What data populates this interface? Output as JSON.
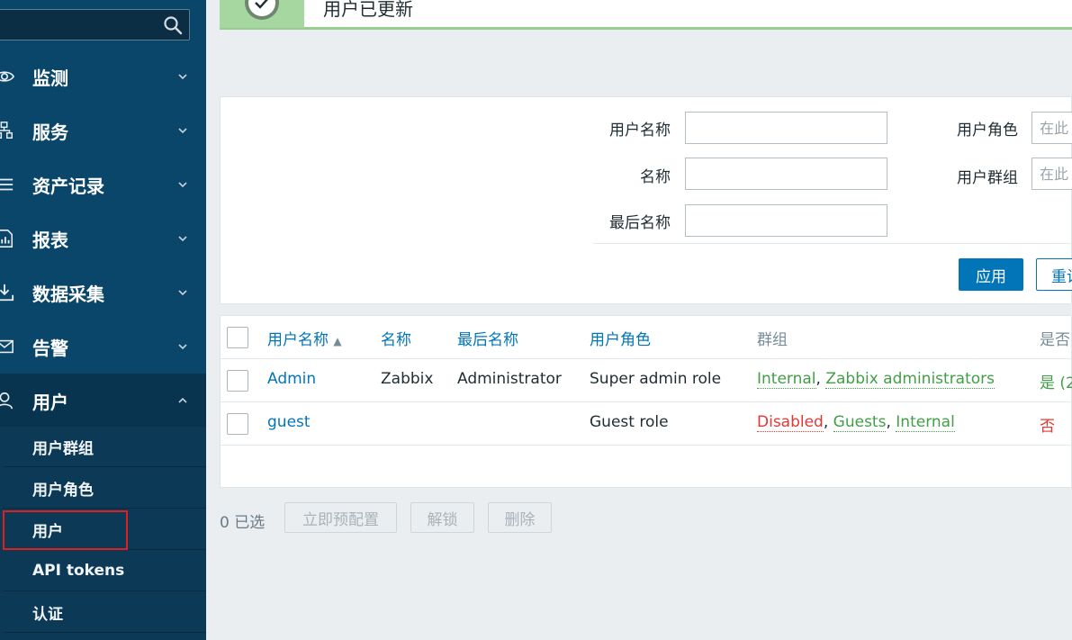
{
  "sidebar": {
    "search": {
      "placeholder": ""
    },
    "menu": [
      {
        "label": "监测",
        "icon": "eye-icon"
      },
      {
        "label": "服务",
        "icon": "services-icon"
      },
      {
        "label": "资产记录",
        "icon": "list-icon"
      },
      {
        "label": "报表",
        "icon": "report-icon"
      },
      {
        "label": "数据采集",
        "icon": "download-icon"
      },
      {
        "label": "告警",
        "icon": "envelope-icon"
      },
      {
        "label": "用户",
        "icon": "user-icon",
        "expanded": true
      }
    ],
    "submenu": [
      {
        "label": "用户群组"
      },
      {
        "label": "用户角色"
      },
      {
        "label": "用户",
        "active": true
      },
      {
        "label": "API tokens"
      },
      {
        "label": "认证"
      }
    ]
  },
  "message": {
    "text": "用户已更新",
    "icon": "check-icon"
  },
  "filter": {
    "username_label": "用户名称",
    "name_label": "名称",
    "lastname_label": "最后名称",
    "role_label": "用户角色",
    "group_label": "用户群组",
    "role_placeholder": "在此",
    "group_placeholder": "在此",
    "apply": "应用",
    "reset": "重设"
  },
  "table": {
    "headers": {
      "username": "用户名称",
      "name": "名称",
      "lastname": "最后名称",
      "role": "用户角色",
      "groups": "群组",
      "status": "是否"
    },
    "rows": [
      {
        "username": "Admin",
        "name": "Zabbix",
        "lastname": "Administrator",
        "role": "Super admin role",
        "groups": [
          {
            "text": "Internal",
            "color": "green"
          },
          {
            "text": "Zabbix administrators",
            "color": "green"
          }
        ],
        "status": "是 (2",
        "status_color": "green"
      },
      {
        "username": "guest",
        "name": "",
        "lastname": "",
        "role": "Guest role",
        "groups": [
          {
            "text": "Disabled",
            "color": "red"
          },
          {
            "text": "Guests",
            "color": "green"
          },
          {
            "text": "Internal",
            "color": "green"
          }
        ],
        "status": "否",
        "status_color": "red"
      }
    ]
  },
  "footer": {
    "selected": "0 已选",
    "buttons": [
      "立即预配置",
      "解锁",
      "删除"
    ]
  },
  "colors": {
    "sidebar": "#0a466a",
    "accent": "#0275b8",
    "green": "#429e47",
    "red": "#e33734",
    "success": "#a7d7a0"
  }
}
